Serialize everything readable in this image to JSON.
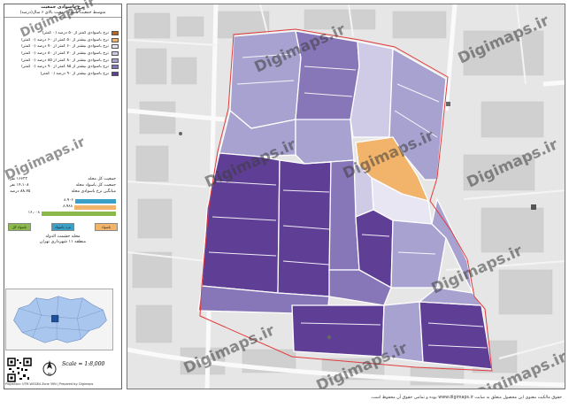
{
  "legend": {
    "title": "نرخ باسوادی جمعیت",
    "subtitle": "متوسط جمعیت باسواد جمعیت بالای ۶ سال(درصد)",
    "classes": [
      {
        "label": "نرخ باسوادی کمتر از ۵۰ درصد (۰ کمتر)",
        "color": "#b8651b"
      },
      {
        "label": "نرخ باسوادی بیشتر از ۵۰ کمتر از ۶۰ درصد (۰ کمتر)",
        "color": "#f2b36a"
      },
      {
        "label": "نرخ باسوادی بیشتر از ۶۰ کمتر از ۷۰ درصد (۰ کمتر)",
        "color": "#e9e6f4"
      },
      {
        "label": "نرخ باسوادی بیشتر از ۷۰ کمتر از ۸۰ درصد (۰ کمتر)",
        "color": "#cfcbe6"
      },
      {
        "label": "نرخ باسوادی بیشتر از ۸۰ کمتر از ۸۵ درصد (۰ کمتر)",
        "color": "#a8a2d0"
      },
      {
        "label": "نرخ باسوادی بیشتر از ۸۵ کمتر از ۹۰ درصد (۰ کمتر)",
        "color": "#8777b8"
      },
      {
        "label": "نرخ باسوادی بیشتر از ۹۰ درصد (۰ کمتر)",
        "color": "#5f3f96"
      }
    ],
    "stats": [
      {
        "label": "جمعیت کل محله",
        "value": "۱۶۶۲۲ نفر"
      },
      {
        "label": "جمعیت کل باسواد محله",
        "value": "۱۴،۱۰۸ نفر"
      },
      {
        "label": "میانگین نرخ باسوادی محله",
        "value": "۸۸.۷۵ درصد"
      }
    ],
    "bars": [
      {
        "label": "۱۶،۰۰۸",
        "color": "#8ab84a",
        "fraction": 1.0
      },
      {
        "label": "۸،۹۸۸",
        "color": "#f2b36a",
        "fraction": 0.56
      },
      {
        "label": "۸،۹۰۶",
        "color": "#3aa0c8",
        "fraction": 0.55
      }
    ],
    "categories": [
      {
        "label": "باسواد",
        "color": "#f2b36a"
      },
      {
        "label": "مرد باسواد",
        "color": "#3aa0c8"
      },
      {
        "label": "باسواد کل",
        "color": "#8ab84a"
      }
    ],
    "neighborhood": "محله حشمت الدوله",
    "district": "منطقه ۱۱ شهرداری تهران",
    "scale": "Scale = 1:8,000",
    "credit": "Projection: UTM WGS84 Zone 39N | Prepared by: Digimaps"
  },
  "map": {
    "watermark": "Digimaps.ir",
    "footer": "حقوق مالکیت معنوی این محصول متعلق به سایت www.digimaps.ir بوده و تمامی حقوق آن محفوظ است."
  }
}
